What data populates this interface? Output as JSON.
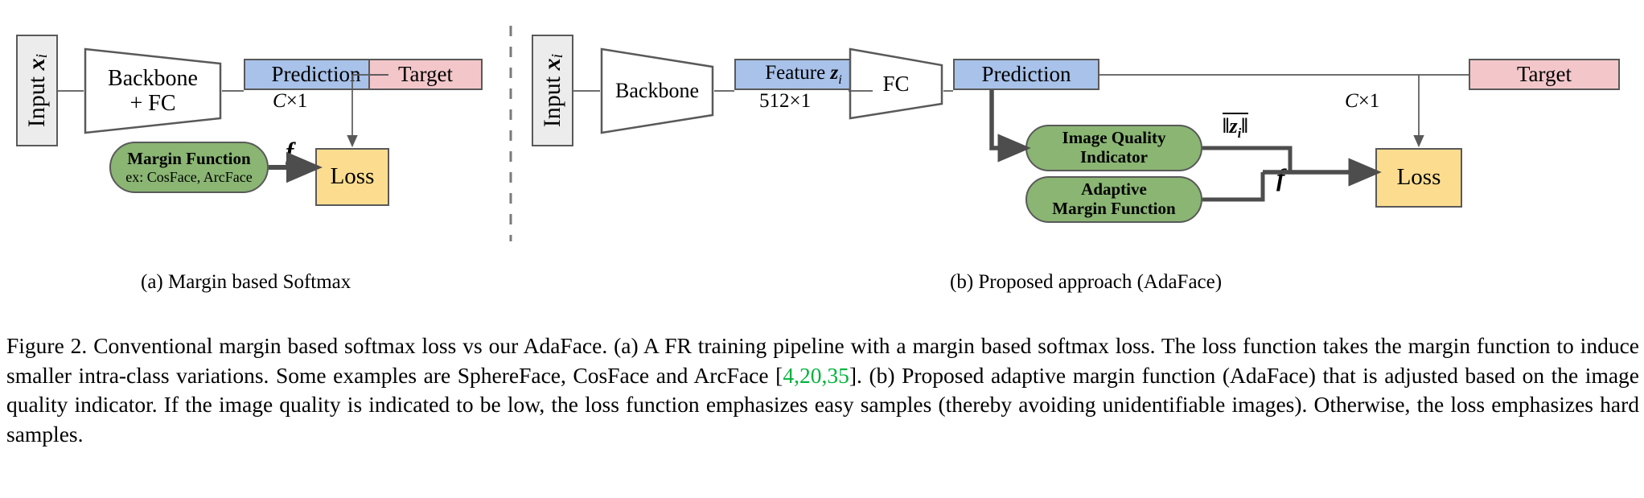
{
  "figure": {
    "caption_number": "Figure 2.",
    "caption_line1": "Conventional margin based softmax loss vs our AdaFace. (a) A FR training pipeline with a margin based softmax loss. The loss",
    "caption_line2a": "function takes the margin function to induce smaller intra-class variations. Some examples are SphereFace, CosFace and ArcFace [",
    "citations": "4,20,35",
    "caption_line2b": "].",
    "caption_line3": "(b) Proposed adaptive margin function (AdaFace) that is adjusted based on the image quality indicator. If the image quality is indicated to",
    "caption_line4": "be low, the loss function emphasizes easy samples (thereby avoiding unidentifiable images). Otherwise, the loss emphasizes hard samples.",
    "citation_color": "#00b33c"
  },
  "panel_a": {
    "sub_caption": "(a) Margin based Softmax",
    "input_label": "Input",
    "input_var": "x",
    "input_sub": "i",
    "backbone_line1": "Backbone",
    "backbone_line2": "+ FC",
    "prediction": "Prediction",
    "prediction_dim_var": "C",
    "prediction_dim_rest": "×1",
    "target": "Target",
    "margin_title": "Margin Function",
    "margin_examples": "ex: CosFace, ArcFace",
    "flow_label": "f",
    "loss": "Loss"
  },
  "panel_b": {
    "sub_caption": "(b) Proposed approach (AdaFace)",
    "input_label": "Input",
    "input_var": "x",
    "input_sub": "i",
    "backbone": "Backbone",
    "feature_label": "Feature",
    "feature_var": "z",
    "feature_sub": "i",
    "feature_dim": "512×1",
    "fc": "FC",
    "prediction": "Prediction",
    "prediction_dim_var": "C",
    "prediction_dim_rest": "×1",
    "target": "Target",
    "iqi_line1": "Image Quality",
    "iqi_line2": "Indicator",
    "amf_line1": "Adaptive",
    "amf_line2": "Margin Function",
    "norm_open": "‖",
    "norm_var": "z",
    "norm_sub": "i",
    "norm_close": "‖",
    "flow_label": "f",
    "loss": "Loss"
  },
  "colors": {
    "input_box": "#ececec",
    "prediction_box": "#a8c2ea",
    "target_box": "#f3c7ca",
    "loss_box": "#fcdd8f",
    "function_pill": "#8ab573",
    "stroke": "#595959"
  }
}
